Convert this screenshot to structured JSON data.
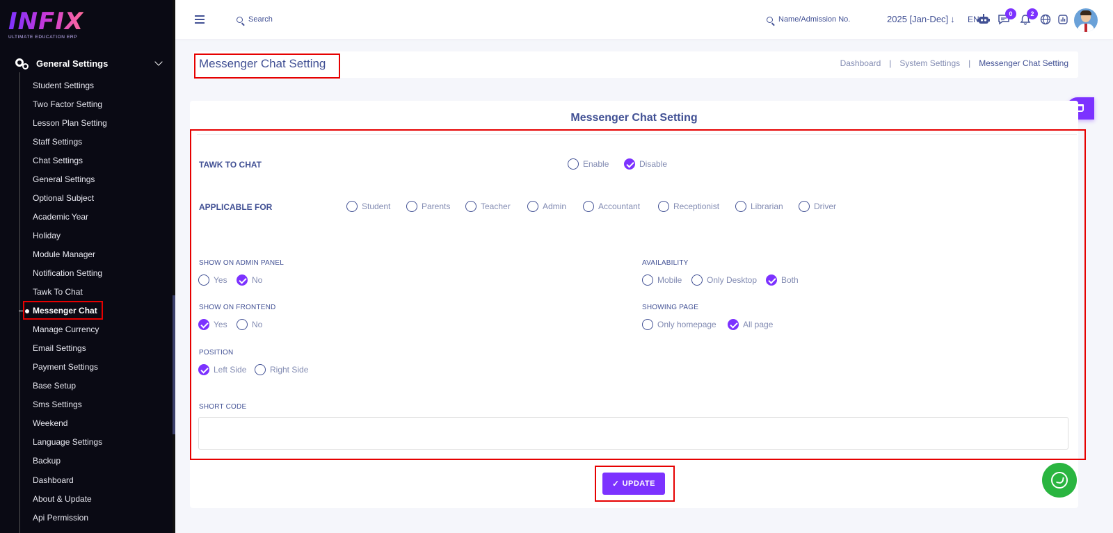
{
  "brand": {
    "logo_text": "INFIX",
    "tagline": "ULTIMATE EDUCATION ERP"
  },
  "sidebar": {
    "group_label": "General Settings",
    "items": [
      "Student Settings",
      "Two Factor Setting",
      "Lesson Plan Setting",
      "Staff Settings",
      "Chat Settings",
      "General Settings",
      "Optional Subject",
      "Academic Year",
      "Holiday",
      "Module Manager",
      "Notification Setting",
      "Tawk To Chat",
      "Messenger Chat",
      "Manage Currency",
      "Email Settings",
      "Payment Settings",
      "Base Setup",
      "Sms Settings",
      "Weekend",
      "Language Settings",
      "Backup",
      "Dashboard",
      "About & Update",
      "Api Permission"
    ],
    "active_index": 12
  },
  "header": {
    "search_label": "Search",
    "admission_search_label": "Name/Admission No.",
    "year": "2025 [Jan-Dec]",
    "language": "EN",
    "chat_badge": "0",
    "notification_badge": "2"
  },
  "page": {
    "title": "Messenger Chat Setting",
    "breadcrumb": [
      "Dashboard",
      "System Settings",
      "Messenger Chat Setting"
    ]
  },
  "form": {
    "heading": "Messenger Chat Setting",
    "tawk_label": "TAWK TO CHAT",
    "tawk_options": [
      "Enable",
      "Disable"
    ],
    "applicable_label": "APPLICABLE FOR",
    "applicable_options": [
      "Student",
      "Parents",
      "Teacher",
      "Admin",
      "Accountant",
      "Receptionist",
      "Librarian",
      "Driver"
    ],
    "admin_panel_label": "SHOW ON ADMIN PANEL",
    "admin_panel_options": [
      "Yes",
      "No"
    ],
    "availability_label": "AVAILABILITY",
    "availability_options": [
      "Mobile",
      "Only Desktop",
      "Both"
    ],
    "frontend_label": "SHOW ON FRONTEND",
    "frontend_options": [
      "Yes",
      "No"
    ],
    "showing_page_label": "SHOWING PAGE",
    "showing_page_options": [
      "Only homepage",
      "All page"
    ],
    "position_label": "POSITION",
    "position_options": [
      "Left Side",
      "Right Side"
    ],
    "short_code_label": "SHORT CODE",
    "short_code_value": "",
    "update_label": "UPDATE"
  },
  "colors": {
    "accent": "#7c32ff",
    "text": "#415094",
    "highlight": "#e60000",
    "whatsapp": "#2ab540"
  }
}
